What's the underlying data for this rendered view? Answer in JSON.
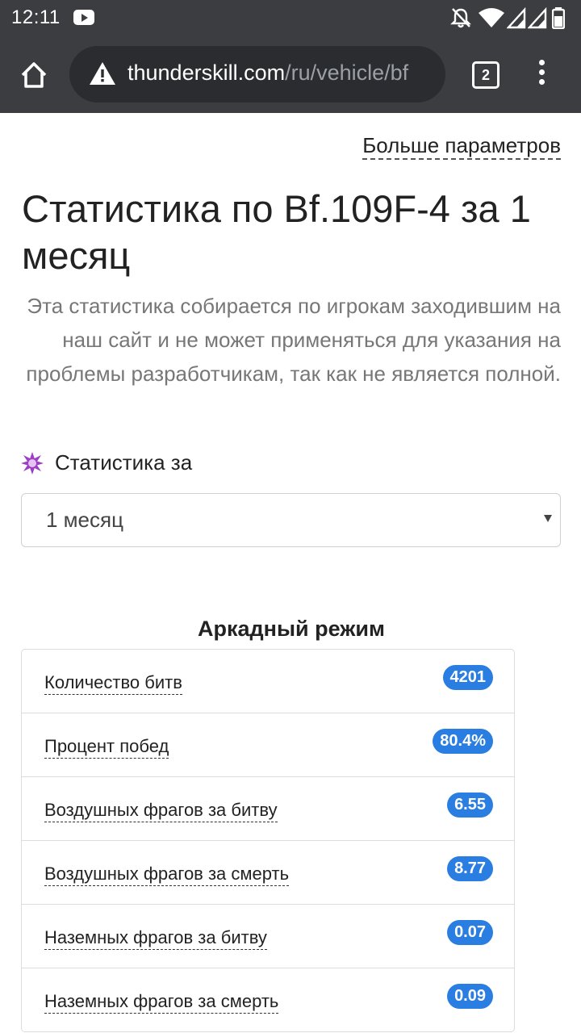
{
  "status_bar": {
    "time": "12:11"
  },
  "browser": {
    "url_domain": "thunderskill.com",
    "url_path": "/ru/vehicle/bf",
    "tab_count": "2"
  },
  "page": {
    "more_params_link": "Больше параметров",
    "title": "Статистика по Bf.109F-4 за 1 месяц",
    "disclaimer": "Эта статистика собирается по игрокам заходившим на наш сайт и не может применяться для указания на проблемы разработчикам, так как не является полной.",
    "period_label": "Статистика за",
    "period_selected": "1 месяц"
  },
  "arcade": {
    "title": "Аркадный режим",
    "rows": [
      {
        "label": "Количество битв",
        "value": "4201"
      },
      {
        "label": "Процент побед",
        "value": "80.4%"
      },
      {
        "label": "Воздушных фрагов за битву",
        "value": "6.55"
      },
      {
        "label": "Воздушных фрагов за смерть",
        "value": "8.77"
      },
      {
        "label": "Наземных фрагов за битву",
        "value": "0.07"
      },
      {
        "label": "Наземных фрагов за смерть",
        "value": "0.09"
      }
    ]
  },
  "colors": {
    "badge": "#2a7de1",
    "browser_bar": "#3c3d40",
    "sparkle": "#9b3fc4"
  },
  "icons": {
    "home": "home-icon",
    "warning": "warning-icon",
    "tabs": "tabs-icon",
    "menu": "more-vert-icon",
    "sparkle": "sparkle-icon"
  }
}
